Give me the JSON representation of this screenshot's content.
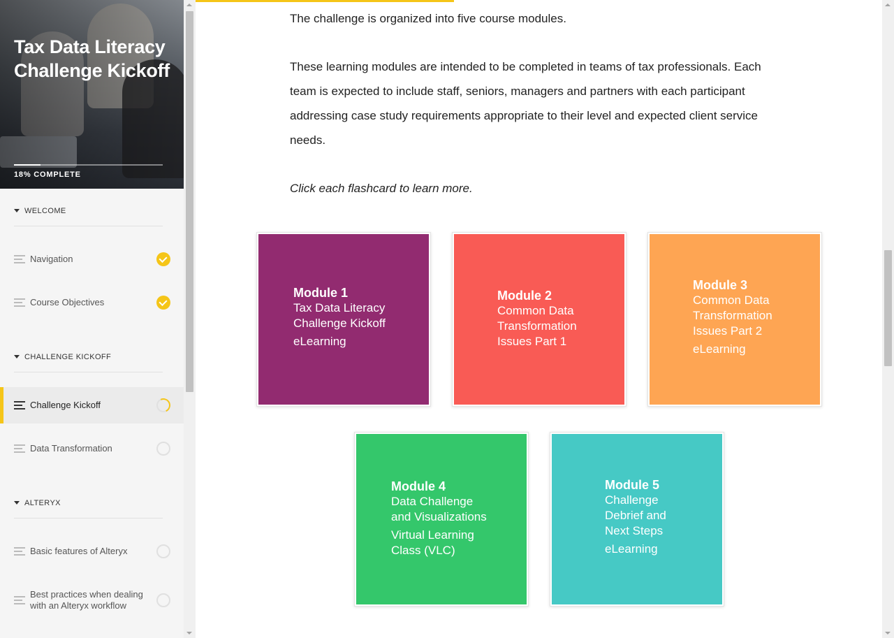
{
  "course": {
    "title": "Tax Data Literacy Challenge Kickoff",
    "progress_percent": 18,
    "progress_label": "18% COMPLETE"
  },
  "sidebar": {
    "sections": [
      {
        "label": "WELCOME",
        "lessons": [
          {
            "label": "Navigation",
            "status": "complete"
          },
          {
            "label": "Course Objectives",
            "status": "complete"
          }
        ]
      },
      {
        "label": "CHALLENGE KICKOFF",
        "lessons": [
          {
            "label": "Challenge Kickoff",
            "status": "in-progress",
            "active": true
          },
          {
            "label": "Data Transformation",
            "status": "not-started"
          }
        ]
      },
      {
        "label": "ALTERYX",
        "lessons": [
          {
            "label": "Basic features of Alteryx",
            "status": "not-started"
          },
          {
            "label": "Best practices when dealing with an Alteryx workflow",
            "status": "not-started"
          }
        ]
      }
    ]
  },
  "main": {
    "paragraphs": [
      "The challenge is organized into five course modules.",
      "These learning modules are intended to be completed in teams of tax professionals. Each team is expected to include staff, seniors, managers and partners with each participant addressing case study requirements appropriate to their level and expected client service needs.",
      "Click each flashcard to learn more."
    ],
    "flashcards": [
      {
        "title": "Module 1",
        "body": "Tax Data Literacy Challenge Kickoff",
        "format": "eLearning",
        "color": "#922b70"
      },
      {
        "title": "Module 2",
        "body": "Common Data Transformation Issues Part 1",
        "format": "",
        "color": "#f95b55"
      },
      {
        "title": "Module 3",
        "body": "Common Data Transformation Issues Part 2",
        "format": "eLearning",
        "color": "#fea553"
      },
      {
        "title": "Module 4",
        "body": "Data Challenge and Visualizations",
        "format": "Virtual Learning Class (VLC)",
        "color": "#34c76b"
      },
      {
        "title": "Module 5",
        "body": "Challenge Debrief and Next Steps",
        "format": "eLearning",
        "color": "#46c9c5"
      }
    ]
  }
}
